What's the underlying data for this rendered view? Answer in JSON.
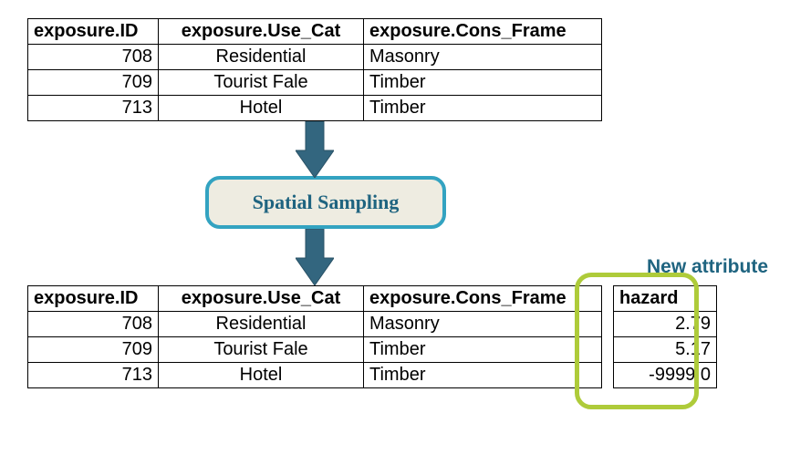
{
  "table_headers": {
    "id": "exposure.ID",
    "usecat": "exposure.Use_Cat",
    "frame": "exposure.Cons_Frame",
    "hazard": "hazard"
  },
  "table1": [
    {
      "id": "708",
      "usecat": "Residential",
      "frame": "Masonry"
    },
    {
      "id": "709",
      "usecat": "Tourist Fale",
      "frame": "Timber"
    },
    {
      "id": "713",
      "usecat": "Hotel",
      "frame": "Timber"
    }
  ],
  "process_label": "Spatial Sampling",
  "new_attribute_label": "New attribute",
  "table2": [
    {
      "id": "708",
      "usecat": "Residential",
      "frame": "Masonry",
      "hazard": "2.79"
    },
    {
      "id": "709",
      "usecat": "Tourist Fale",
      "frame": "Timber",
      "hazard": "5.17"
    },
    {
      "id": "713",
      "usecat": "Hotel",
      "frame": "Timber",
      "hazard": "-9999.0"
    }
  ]
}
